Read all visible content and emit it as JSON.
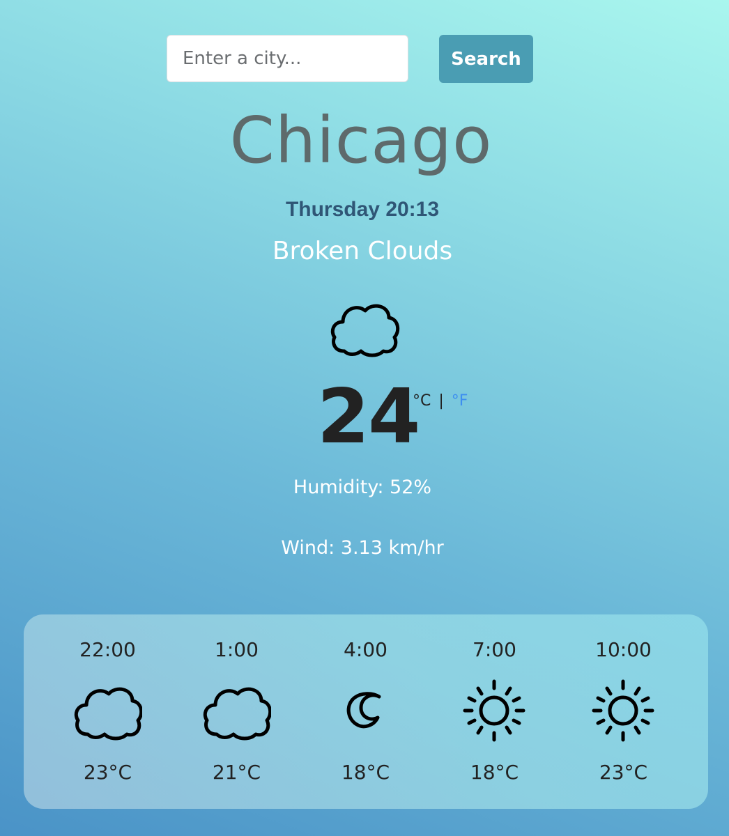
{
  "search": {
    "placeholder": "Enter a city...",
    "button_label": "Search"
  },
  "current": {
    "city": "Chicago",
    "datetime": "Thursday 20:13",
    "description": "Broken Clouds",
    "icon": "cloud-icon",
    "temperature": "24",
    "unit_c": "°C",
    "unit_separator": "|",
    "unit_f": "°F",
    "humidity": "Humidity: 52%",
    "wind": "Wind: 3.13 km/hr"
  },
  "forecast": [
    {
      "time": "22:00",
      "icon": "cloud-icon",
      "temp": "23°C"
    },
    {
      "time": "1:00",
      "icon": "cloud-icon",
      "temp": "21°C"
    },
    {
      "time": "4:00",
      "icon": "moon-icon",
      "temp": "18°C"
    },
    {
      "time": "7:00",
      "icon": "sun-icon",
      "temp": "18°C"
    },
    {
      "time": "10:00",
      "icon": "sun-icon",
      "temp": "23°C"
    }
  ],
  "colors": {
    "button_bg": "#4a9db3",
    "city_text": "#5e6a6b",
    "datetime_text": "#2f5676",
    "fahrenheit_link": "#3d8ef0"
  }
}
